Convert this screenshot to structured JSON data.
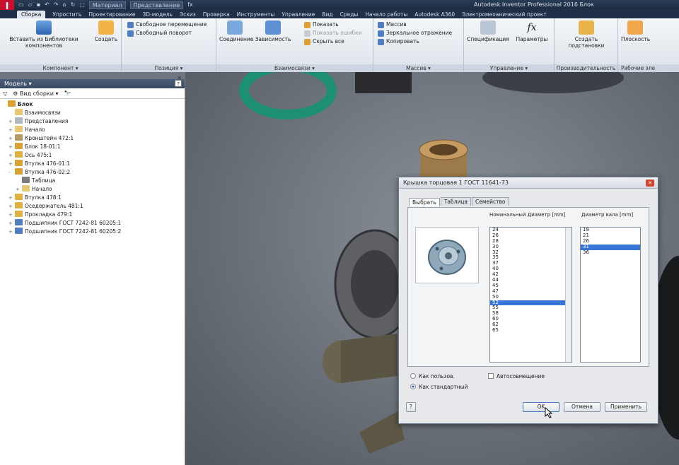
{
  "app": {
    "title": "Autodesk Inventor Professional 2016   Блок",
    "qat_material": "Материал",
    "qat_appearance": "Представление"
  },
  "ribbon_tabs": [
    "Сборка",
    "Упростить",
    "Проектирование",
    "3D-модель",
    "Эскиз",
    "Проверка",
    "Инструменты",
    "Управление",
    "Вид",
    "Среды",
    "Начало работы",
    "Autodesk A360",
    "Электромеханический проект"
  ],
  "ribbon": {
    "component": {
      "insert": "Вставить из Библиотеки компонентов",
      "create": "Создать",
      "label": "Компонент ▾"
    },
    "position": {
      "free_move": "Свободное перемещение",
      "free_rotate": "Свободный поворот",
      "label": "Позиция ▾"
    },
    "relationships": {
      "joint": "Соединение",
      "constrain": "Зависимость",
      "show": "Показать",
      "show_sick": "Показать ошибки",
      "hide_all": "Скрыть все",
      "label": "Взаимосвязи ▾"
    },
    "pattern": {
      "pattern": "Массив",
      "mirror": "Зеркальное отражение",
      "copy": "Копировать",
      "label": "Массив ▾"
    },
    "manage": {
      "bom": "Спецификация",
      "params": "Параметры",
      "label": "Управление ▾"
    },
    "productivity": {
      "create_sub": "Создать подстановки",
      "label": "Производительность"
    },
    "work": {
      "plane": "Плоскость",
      "label": "Рабочие эле"
    }
  },
  "browser": {
    "title": "Модель ▾",
    "view": "Вид сборки",
    "tree": [
      {
        "label": "Блок",
        "level": 0,
        "exp": "",
        "color": "#d9a232"
      },
      {
        "label": "Взаимосвязи",
        "level": 1,
        "exp": "",
        "color": "#e8c870"
      },
      {
        "label": "Представления",
        "level": 1,
        "exp": "+",
        "color": "#b0b8c0"
      },
      {
        "label": "Начало",
        "level": 1,
        "exp": "+",
        "color": "#e8c870"
      },
      {
        "label": "Кронштейн 472:1",
        "level": 1,
        "exp": "+",
        "color": "#b49a68"
      },
      {
        "label": "Блок 18-01:1",
        "level": 1,
        "exp": "+",
        "color": "#d9a232"
      },
      {
        "label": "Ось 475:1",
        "level": 1,
        "exp": "+",
        "color": "#e0b040"
      },
      {
        "label": "Втулка 476-01:1",
        "level": 1,
        "exp": "+",
        "color": "#d9a232"
      },
      {
        "label": "Втулка 476-02:2",
        "level": 1,
        "exp": "-",
        "color": "#d9a232"
      },
      {
        "label": "Таблица",
        "level": 2,
        "exp": "",
        "color": "#7c7c7c"
      },
      {
        "label": "Начало",
        "level": 2,
        "exp": "+",
        "color": "#e8c870"
      },
      {
        "label": "Втулка 478:1",
        "level": 1,
        "exp": "+",
        "color": "#e0b040"
      },
      {
        "label": "Оседержатель 481:1",
        "level": 1,
        "exp": "+",
        "color": "#e0b040"
      },
      {
        "label": "Прокладка 479:1",
        "level": 1,
        "exp": "+",
        "color": "#e0b040"
      },
      {
        "label": "Подшипник ГОСТ 7242-81 60205:1",
        "level": 1,
        "exp": "+",
        "color": "#4f7fc0"
      },
      {
        "label": "Подшипник ГОСТ 7242-81 60205:2",
        "level": 1,
        "exp": "+",
        "color": "#4f7fc0"
      }
    ]
  },
  "dialog": {
    "title": "Крышка торцовая 1 ГОСТ 11641-73",
    "tabs": [
      "Выбрать",
      "Таблица",
      "Семейство"
    ],
    "col1_header": "Номинальный Диаметр [mm]",
    "col2_header": "Диаметр вала [mm]",
    "diameters": [
      "24",
      "26",
      "28",
      "30",
      "32",
      "35",
      "37",
      "40",
      "42",
      "44",
      "45",
      "47",
      "50",
      "52",
      "55",
      "58",
      "60",
      "62",
      "65"
    ],
    "selected_diameter": "52",
    "shafts": [
      "18",
      "21",
      "26",
      "31",
      "36"
    ],
    "selected_shaft": "31",
    "radio_custom": "Как пользов.",
    "radio_standard": "Как стандартный",
    "auto_drop": "Автосовмещение",
    "ok": "OK",
    "cancel": "Отмена",
    "apply": "Применить"
  }
}
